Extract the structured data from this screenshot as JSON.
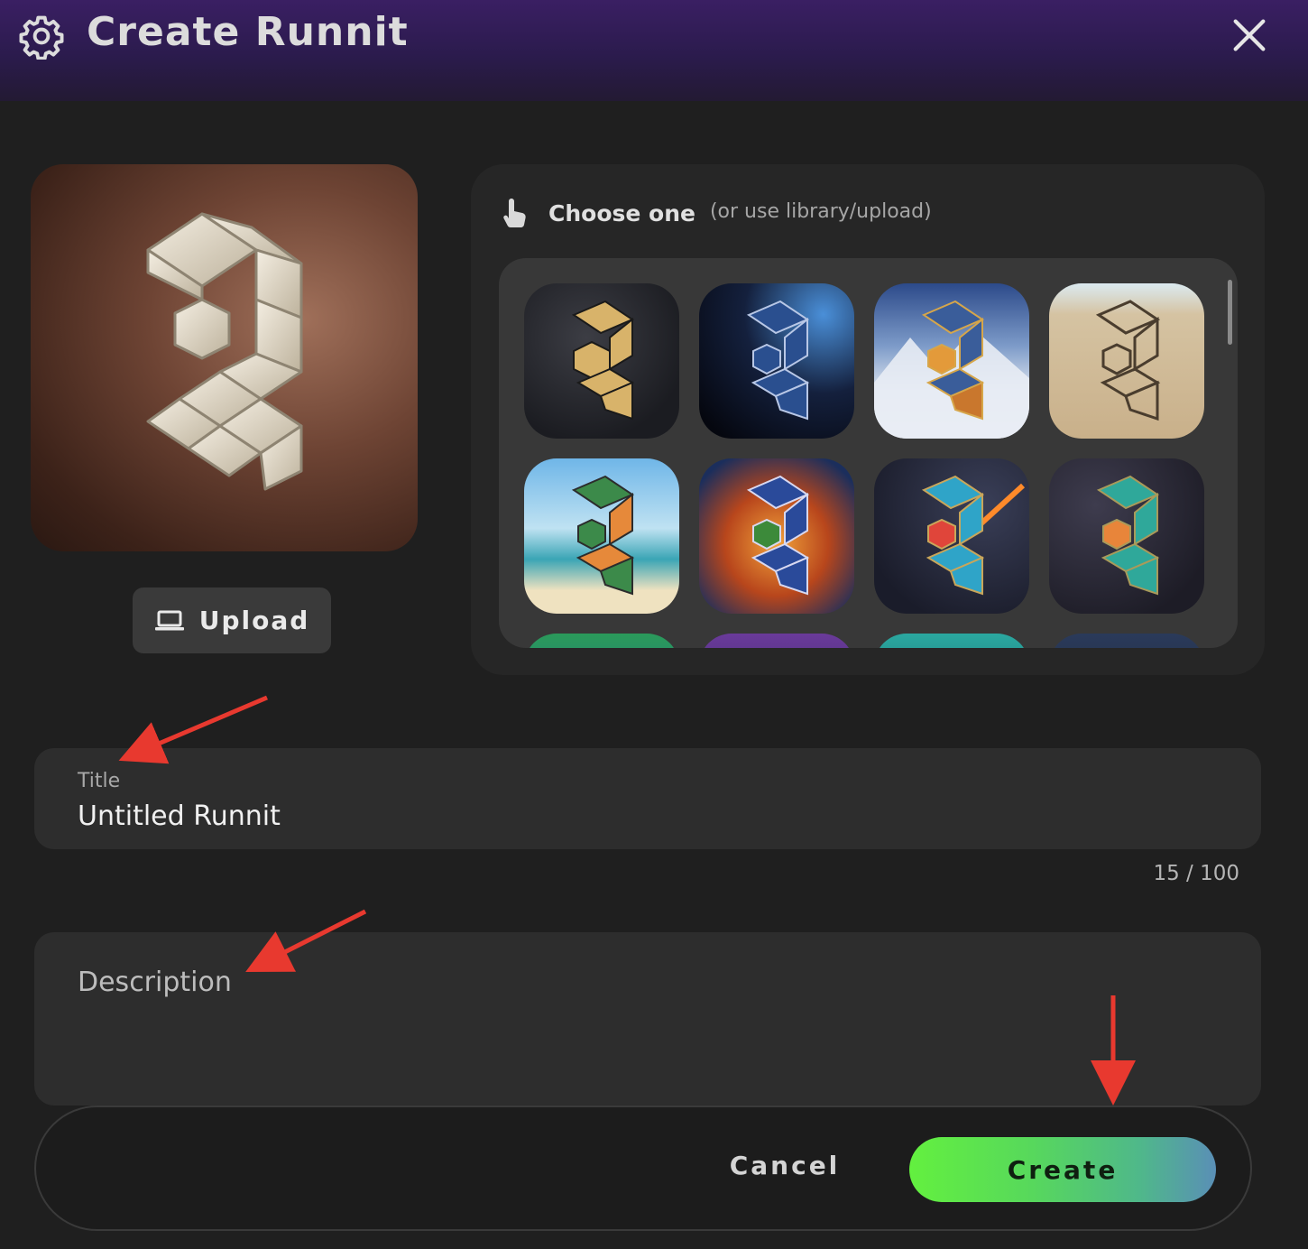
{
  "header": {
    "title": "Create Runnit",
    "settings_icon": "gear-icon",
    "close_icon": "close-icon"
  },
  "preview": {
    "upload_label": "Upload",
    "upload_icon": "laptop-icon"
  },
  "chooser": {
    "title": "Choose one",
    "subtitle": "(or use library/upload)",
    "icon": "pointer-hand-icon"
  },
  "form": {
    "title_label": "Title",
    "title_value": "Untitled Runnit",
    "title_counter": "15 / 100",
    "description_placeholder": "Description"
  },
  "footer": {
    "cancel_label": "Cancel",
    "create_label": "Create"
  },
  "colors": {
    "accent_green": "#63f03f",
    "accent_blue": "#5a8fb6",
    "annotation_red": "#e8392f"
  }
}
